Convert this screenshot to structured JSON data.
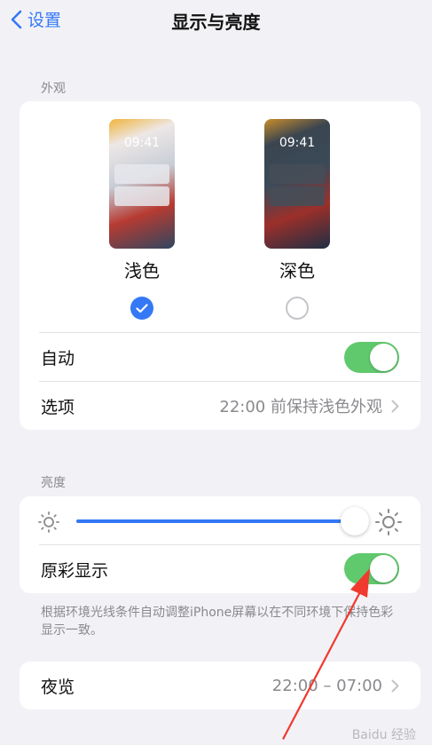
{
  "nav": {
    "back_label": "设置",
    "title": "显示与亮度"
  },
  "appearance": {
    "section_label": "外观",
    "light": {
      "label": "浅色",
      "time": "09:41",
      "selected": true
    },
    "dark": {
      "label": "深色",
      "time": "09:41",
      "selected": false
    },
    "auto": {
      "label": "自动",
      "on": true
    },
    "options": {
      "label": "选项",
      "value": "22:00 前保持浅色外观"
    }
  },
  "brightness": {
    "section_label": "亮度",
    "level": 0.95,
    "true_tone": {
      "label": "原彩显示",
      "on": true
    },
    "footnote": "根据环境光线条件自动调整iPhone屏幕以在不同环境下保持色彩显示一致。"
  },
  "night_shift": {
    "label": "夜览",
    "value": "22:00 – 07:00"
  },
  "watermark": "Baidu 经验",
  "colors": {
    "accent": "#3478f6",
    "toggle_on": "#61c96d",
    "arrow": "#f03a2f",
    "background": "#f2f2f6"
  }
}
